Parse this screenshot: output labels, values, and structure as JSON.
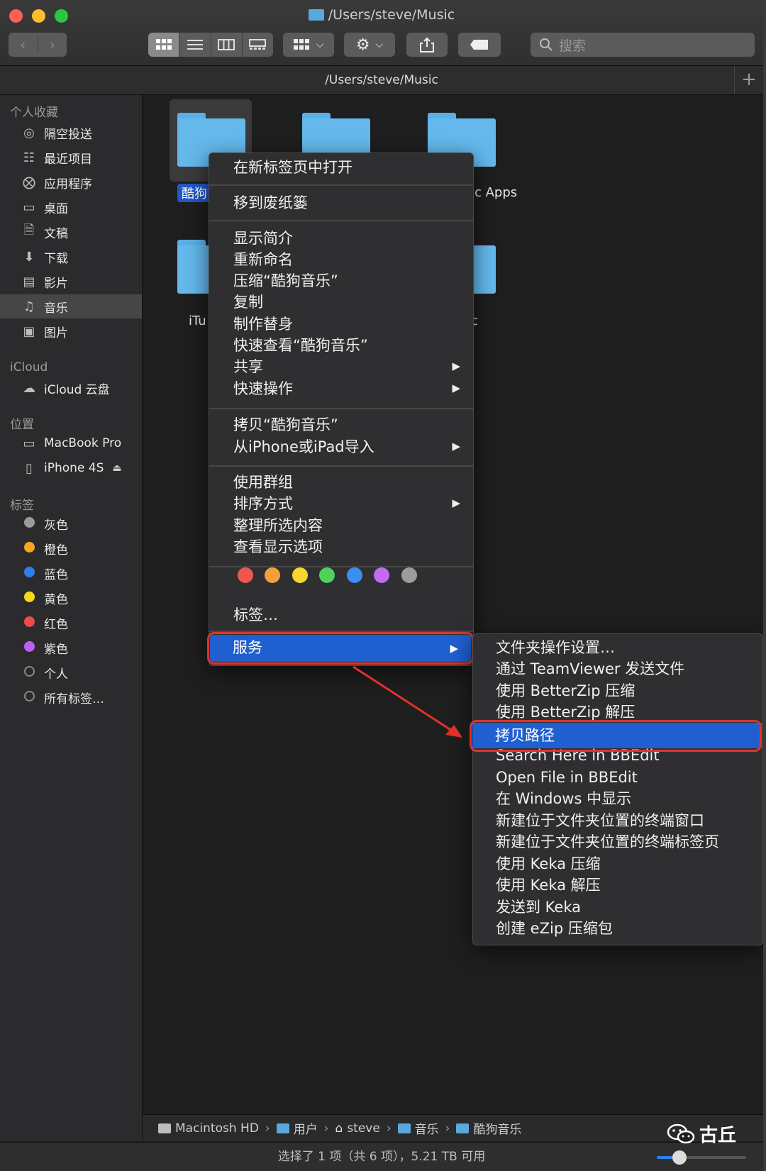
{
  "window": {
    "title": "/Users/steve/Music",
    "path": "/Users/steve/Music",
    "search_placeholder": "搜索"
  },
  "sidebar": {
    "favorites_header": "个人收藏",
    "favorites": [
      {
        "label": "隔空投送",
        "icon": "airdrop-icon"
      },
      {
        "label": "最近项目",
        "icon": "recents-icon"
      },
      {
        "label": "应用程序",
        "icon": "applications-icon"
      },
      {
        "label": "桌面",
        "icon": "desktop-icon"
      },
      {
        "label": "文稿",
        "icon": "documents-icon"
      },
      {
        "label": "下载",
        "icon": "downloads-icon"
      },
      {
        "label": "影片",
        "icon": "movies-icon"
      },
      {
        "label": "音乐",
        "icon": "music-icon"
      },
      {
        "label": "图片",
        "icon": "pictures-icon"
      }
    ],
    "icloud_header": "iCloud",
    "icloud": [
      {
        "label": "iCloud 云盘",
        "icon": "cloud-icon"
      }
    ],
    "locations_header": "位置",
    "locations": [
      {
        "label": "MacBook Pro",
        "icon": "laptop-icon"
      },
      {
        "label": "iPhone 4S",
        "icon": "phone-icon"
      }
    ],
    "tags_header": "标签",
    "tags": [
      {
        "label": "灰色",
        "color": "#9a9a9a"
      },
      {
        "label": "橙色",
        "color": "#f5a623"
      },
      {
        "label": "蓝色",
        "color": "#2f80ed"
      },
      {
        "label": "黄色",
        "color": "#f8d81c"
      },
      {
        "label": "红色",
        "color": "#ee4b4b"
      },
      {
        "label": "紫色",
        "color": "#bd5ff0"
      },
      {
        "label": "个人",
        "color": "#1f1f1f"
      },
      {
        "label": "所有标签…",
        "color": "#1f1f1f"
      }
    ]
  },
  "content": {
    "folders": [
      {
        "label": "酷狗"
      },
      {
        "label": "ic Apps"
      },
      {
        "label": "iTu"
      },
      {
        "label": "c"
      }
    ]
  },
  "context_menu": {
    "items": [
      {
        "label": "在新标签页中打开"
      },
      {
        "label": "移到废纸篓"
      },
      {
        "label": "显示简介"
      },
      {
        "label": "重新命名"
      },
      {
        "label": "压缩“酷狗音乐”"
      },
      {
        "label": "复制"
      },
      {
        "label": "制作替身"
      },
      {
        "label": "快速查看“酷狗音乐”"
      },
      {
        "label": "共享"
      },
      {
        "label": "快速操作"
      },
      {
        "label": "拷贝“酷狗音乐”"
      },
      {
        "label": "从iPhone或iPad导入"
      },
      {
        "label": "使用群组"
      },
      {
        "label": "排序方式"
      },
      {
        "label": "整理所选内容"
      },
      {
        "label": "查看显示选项"
      },
      {
        "label": "标签…"
      },
      {
        "label": "服务"
      }
    ],
    "tag_colors": [
      "#f0564f",
      "#f5a03a",
      "#f8d62f",
      "#4fd15a",
      "#3a8ff0",
      "#c46af0",
      "#9c9c9c"
    ]
  },
  "services_submenu": {
    "items": [
      "文件夹操作设置…",
      "通过 TeamViewer 发送文件",
      "使用 BetterZip 压缩",
      "使用 BetterZip 解压",
      "拷贝路径",
      "Search Here in BBEdit",
      "Open File in BBEdit",
      "在 Windows 中显示",
      "新建位于文件夹位置的终端窗口",
      "新建位于文件夹位置的终端标签页",
      "使用 Keka 压缩",
      "使用 Keka 解压",
      "发送到 Keka",
      "创建 eZip 压缩包"
    ]
  },
  "breadcrumb": [
    {
      "label": "Macintosh HD"
    },
    {
      "label": "用户"
    },
    {
      "label": "steve"
    },
    {
      "label": "音乐"
    },
    {
      "label": "酷狗音乐"
    }
  ],
  "status": {
    "text": "选择了 1 项（共 6 项），5.21 TB 可用",
    "zoom_fraction": 0.25
  },
  "watermark": {
    "text": "古丘"
  }
}
